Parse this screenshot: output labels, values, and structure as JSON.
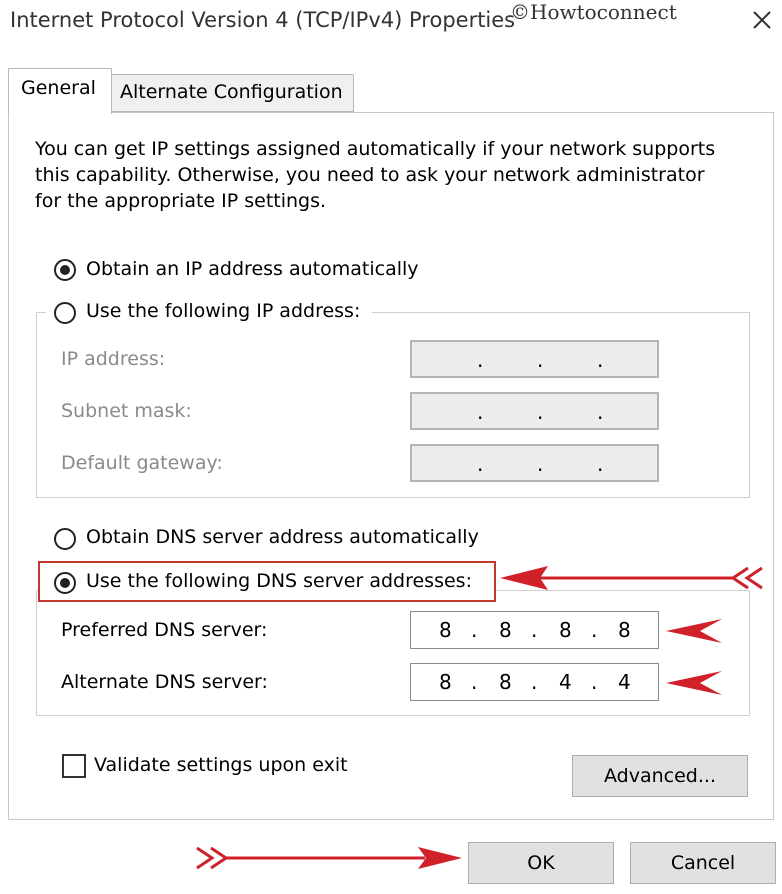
{
  "window": {
    "title": "Internet Protocol Version 4 (TCP/IPv4) Properties",
    "watermark": "©Howtoconnect"
  },
  "tabs": [
    {
      "label": "General",
      "selected": true
    },
    {
      "label": "Alternate Configuration",
      "selected": false
    }
  ],
  "description": "You can get IP settings assigned automatically if your network supports this capability. Otherwise, you need to ask your network administrator for the appropriate IP settings.",
  "ip": {
    "auto_label": "Obtain an IP address automatically",
    "auto_selected": true,
    "manual_label": "Use the following IP address:",
    "manual_selected": false,
    "fields": [
      {
        "label": "IP address:",
        "value": ""
      },
      {
        "label": "Subnet mask:",
        "value": ""
      },
      {
        "label": "Default gateway:",
        "value": ""
      }
    ]
  },
  "dns": {
    "auto_label": "Obtain DNS server address automatically",
    "auto_selected": false,
    "manual_label": "Use the following DNS server addresses:",
    "manual_selected": true,
    "preferred_label": "Preferred DNS server:",
    "preferred_octets": [
      "8",
      "8",
      "8",
      "8"
    ],
    "alternate_label": "Alternate DNS server:",
    "alternate_octets": [
      "8",
      "8",
      "4",
      "4"
    ]
  },
  "validate": {
    "label": "Validate settings upon exit",
    "checked": false
  },
  "buttons": {
    "advanced": "Advanced...",
    "ok": "OK",
    "cancel": "Cancel"
  },
  "colors": {
    "annotation": "#d0202a",
    "highlight_border": "#c0392b"
  }
}
